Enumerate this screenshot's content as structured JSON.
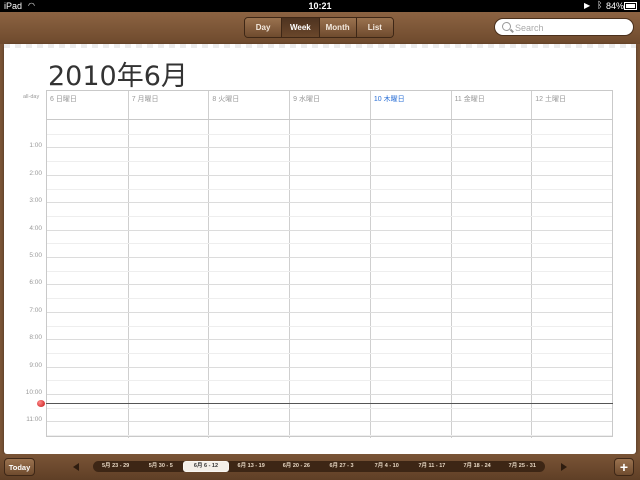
{
  "status_bar": {
    "device": "iPad",
    "time": "10:21",
    "battery_percent": "84%",
    "wifi_icon": "wifi-icon",
    "play_icon": "play-icon",
    "bluetooth_icon": "bluetooth-icon"
  },
  "toolbar": {
    "view_tabs": [
      {
        "label": "Day",
        "active": false
      },
      {
        "label": "Week",
        "active": true
      },
      {
        "label": "Month",
        "active": false
      },
      {
        "label": "List",
        "active": false
      }
    ],
    "search_placeholder": "Search"
  },
  "calendar": {
    "month_title": "2010年6月",
    "allday_label": "all-day",
    "days": [
      {
        "label": "6 日曜日",
        "today": false
      },
      {
        "label": "7 月曜日",
        "today": false
      },
      {
        "label": "8 火曜日",
        "today": false
      },
      {
        "label": "9 水曜日",
        "today": false
      },
      {
        "label": "10 木曜日",
        "today": true
      },
      {
        "label": "11 金曜日",
        "today": false
      },
      {
        "label": "12 土曜日",
        "today": false
      }
    ],
    "hours": [
      "1:00",
      "2:00",
      "3:00",
      "4:00",
      "5:00",
      "6:00",
      "7:00",
      "8:00",
      "9:00",
      "10:00",
      "11:00"
    ],
    "current_time": "10:21"
  },
  "bottom_bar": {
    "today_label": "Today",
    "add_label": "+",
    "weeks": [
      {
        "label": "5月 23 - 29",
        "selected": false
      },
      {
        "label": "5月 30 - 5",
        "selected": false
      },
      {
        "label": "6月 6 - 12",
        "selected": true
      },
      {
        "label": "6月 13 - 19",
        "selected": false
      },
      {
        "label": "6月 20 - 26",
        "selected": false
      },
      {
        "label": "6月 27 - 3",
        "selected": false
      },
      {
        "label": "7月 4 - 10",
        "selected": false
      },
      {
        "label": "7月 11 - 17",
        "selected": false
      },
      {
        "label": "7月 18 - 24",
        "selected": false
      },
      {
        "label": "7月 25 - 31",
        "selected": false
      }
    ]
  },
  "colors": {
    "leather": "#7a5436",
    "today_blue": "#2a6fd6",
    "now_dot": "#c31313"
  }
}
